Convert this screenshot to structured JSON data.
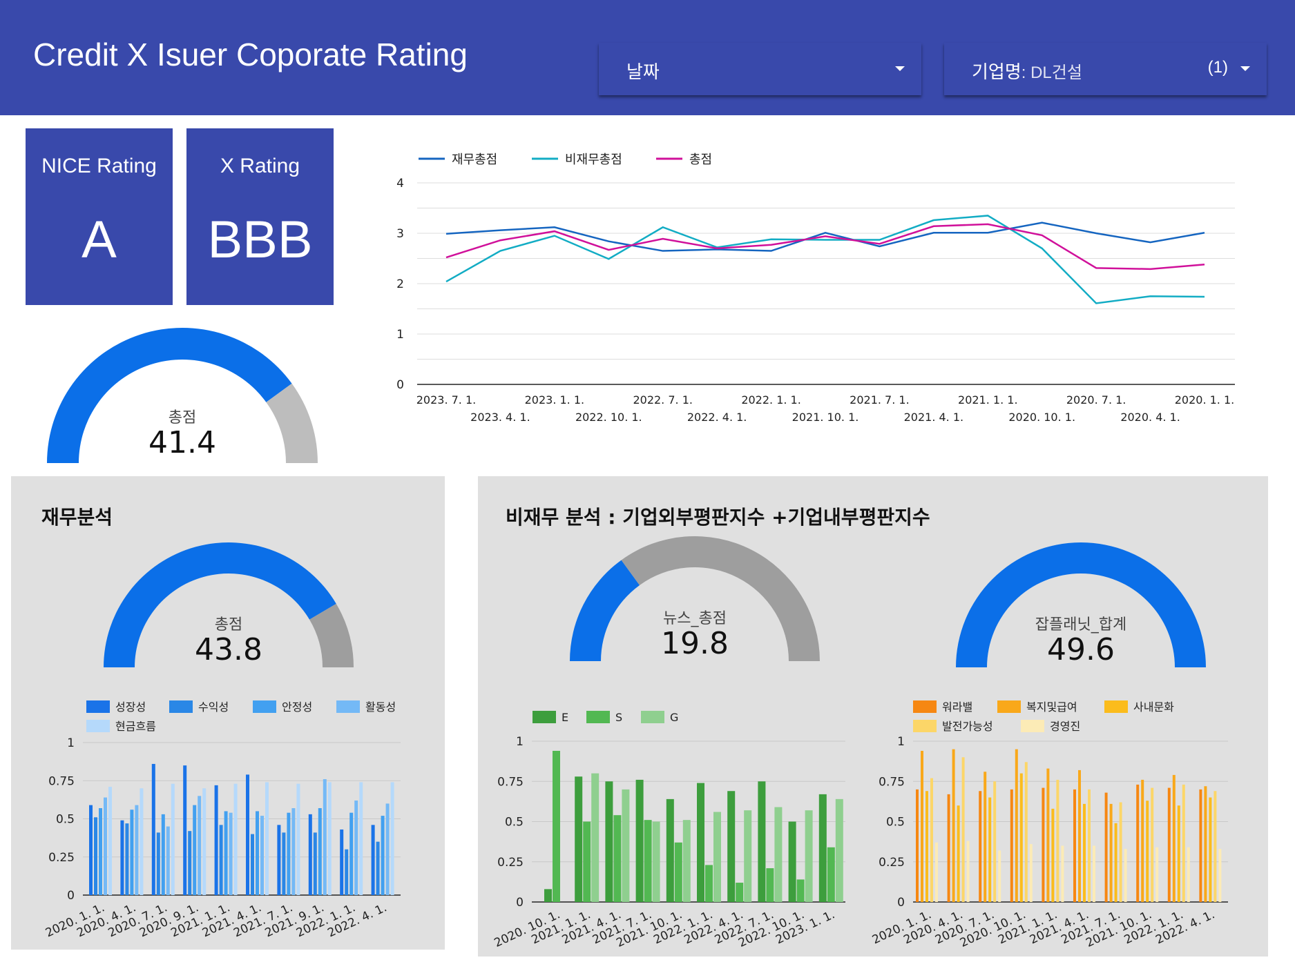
{
  "header": {
    "title": "Credit X Isuer Coporate Rating",
    "date_filter": {
      "label": "날짜"
    },
    "company_filter": {
      "label": "기업명",
      "value": ": DL건설",
      "count": "(1)"
    }
  },
  "scorecards": {
    "nice": {
      "label": "NICE Rating",
      "value": "A"
    },
    "x": {
      "label": "X Rating",
      "value": "BBB"
    }
  },
  "colors": {
    "header": "#3949ab",
    "gauge_fill": "#0b6fe8",
    "gauge_rest_light": "#bdbdbd",
    "gauge_rest_dark": "#9e9e9e",
    "panel_bg": "#e0e0e0"
  },
  "panels": {
    "financial": {
      "title": "재무분석"
    },
    "nonfinancial": {
      "title": "비재무 분석 : 기업외부평판지수 +기업내부평판지수"
    }
  },
  "chart_data": [
    {
      "id": "main-gauge",
      "type": "gauge",
      "label": "총점",
      "value": 41.4,
      "value_text": "41.4",
      "fill_fraction": 0.8
    },
    {
      "id": "score-line",
      "type": "line",
      "x": [
        "2023. 7. 1.",
        "2023. 4. 1.",
        "2023. 1. 1.",
        "2022. 10. 1.",
        "2022. 7. 1.",
        "2022. 4. 1.",
        "2022. 1. 1.",
        "2021. 10. 1.",
        "2021. 7. 1.",
        "2021. 4. 1.",
        "2021. 1. 1.",
        "2020. 10. 1.",
        "2020. 7. 1.",
        "2020. 4. 1.",
        "2020. 1. 1."
      ],
      "series": [
        {
          "name": "재무총점",
          "color": "#1565c0",
          "values": [
            2.99,
            3.06,
            3.12,
            2.84,
            2.65,
            2.68,
            2.65,
            3.01,
            2.74,
            3.01,
            3.01,
            3.21,
            3.0,
            2.82,
            3.01
          ]
        },
        {
          "name": "비재무총점",
          "color": "#12acc4",
          "values": [
            2.04,
            2.65,
            2.95,
            2.49,
            3.12,
            2.72,
            2.88,
            2.87,
            2.87,
            3.26,
            3.35,
            2.7,
            1.61,
            1.75,
            1.74
          ]
        },
        {
          "name": "총점",
          "color": "#d0109a",
          "values": [
            2.52,
            2.86,
            3.04,
            2.67,
            2.89,
            2.7,
            2.77,
            2.94,
            2.79,
            3.14,
            3.18,
            2.96,
            2.31,
            2.29,
            2.38
          ]
        }
      ],
      "yticks": [
        0,
        1,
        2,
        3,
        4
      ],
      "ylim": [
        0,
        4
      ],
      "legend": "top-left",
      "grid": true
    },
    {
      "id": "fin-gauge",
      "type": "gauge",
      "label": "총점",
      "value": 43.8,
      "value_text": "43.8",
      "fill_fraction": 0.83
    },
    {
      "id": "fin-bars",
      "type": "bar",
      "categories": [
        "2020. 1. 1.",
        "2020. 4. 1.",
        "2020. 7. 1.",
        "2020. 9. 1.",
        "2021. 1. 1.",
        "2021. 4. 1.",
        "2021. 7. 1.",
        "2021. 9. 1.",
        "2022. 1. 1.",
        "2022. 4. 1."
      ],
      "series": [
        {
          "name": "성장성",
          "color": "#1a73e8",
          "values": [
            0.59,
            0.49,
            0.86,
            0.85,
            0.72,
            0.79,
            0.46,
            0.53,
            0.43,
            0.46
          ]
        },
        {
          "name": "수익성",
          "color": "#2a87e6",
          "values": [
            0.51,
            0.47,
            0.41,
            0.42,
            0.46,
            0.4,
            0.41,
            0.41,
            0.3,
            0.35
          ]
        },
        {
          "name": "안정성",
          "color": "#42a0f0",
          "values": [
            0.57,
            0.56,
            0.53,
            0.59,
            0.55,
            0.55,
            0.54,
            0.57,
            0.54,
            0.52
          ]
        },
        {
          "name": "활동성",
          "color": "#74b9f6",
          "values": [
            0.64,
            0.59,
            0.45,
            0.65,
            0.54,
            0.52,
            0.57,
            0.76,
            0.62,
            0.6
          ]
        },
        {
          "name": "현금흐름",
          "color": "#b5d9fb",
          "values": [
            0.71,
            0.7,
            0.73,
            0.7,
            0.73,
            0.74,
            0.73,
            0.74,
            0.74,
            0.74
          ]
        }
      ],
      "yticks": [
        "0",
        "0.25",
        "0.5",
        "0.75",
        "1"
      ],
      "ylim": [
        0,
        1
      ]
    },
    {
      "id": "news-gauge",
      "type": "gauge",
      "label": "뉴스_총점",
      "value": 19.8,
      "value_text": "19.8",
      "fill_fraction": 0.3
    },
    {
      "id": "esg-bars",
      "type": "bar",
      "categories": [
        "2020. 10. 1.",
        "2021. 1. 1.",
        "2021. 4. 1.",
        "2021. 7. 1.",
        "2021. 10. 1.",
        "2022. 1. 1.",
        "2022. 4. 1.",
        "2022. 7. 1.",
        "2022. 10. 1.",
        "2023. 1. 1."
      ],
      "series": [
        {
          "name": "E",
          "color": "#3d9e3d",
          "values": [
            0.08,
            0.78,
            0.75,
            0.76,
            0.64,
            0.74,
            0.69,
            0.75,
            0.5,
            0.67
          ]
        },
        {
          "name": "S",
          "color": "#52b852",
          "values": [
            0.94,
            0.5,
            0.54,
            0.51,
            0.37,
            0.23,
            0.12,
            0.21,
            0.14,
            0.34
          ]
        },
        {
          "name": "G",
          "color": "#8fcf8f",
          "values": [
            0.0,
            0.8,
            0.7,
            0.5,
            0.51,
            0.56,
            0.57,
            0.59,
            0.57,
            0.64
          ]
        }
      ],
      "yticks": [
        "0",
        "0.25",
        "0.5",
        "0.75",
        "1"
      ],
      "ylim": [
        0,
        1
      ]
    },
    {
      "id": "job-gauge",
      "type": "gauge",
      "label": "잡플래닛_합계",
      "value": 49.6,
      "value_text": "49.6",
      "fill_fraction": 1.0
    },
    {
      "id": "job-bars",
      "type": "bar",
      "categories": [
        "2020. 1. 1.",
        "2020. 4. 1.",
        "2020. 7. 1.",
        "2020. 10. 1.",
        "2021. 1. 1.",
        "2021. 4. 1.",
        "2021. 7. 1.",
        "2021. 10. 1.",
        "2022. 1. 1.",
        "2022. 4. 1."
      ],
      "series": [
        {
          "name": "워라밸",
          "color": "#f68712",
          "values": [
            0.7,
            0.67,
            0.69,
            0.7,
            0.71,
            0.7,
            0.68,
            0.73,
            0.71,
            0.7
          ]
        },
        {
          "name": "복지및급여",
          "color": "#f9a81a",
          "values": [
            0.94,
            0.95,
            0.81,
            0.95,
            0.83,
            0.82,
            0.61,
            0.76,
            0.79,
            0.72
          ]
        },
        {
          "name": "사내문화",
          "color": "#fbbc1c",
          "values": [
            0.69,
            0.6,
            0.65,
            0.8,
            0.58,
            0.61,
            0.49,
            0.63,
            0.6,
            0.65
          ]
        },
        {
          "name": "발전가능성",
          "color": "#fcd668",
          "values": [
            0.77,
            0.9,
            0.75,
            0.87,
            0.76,
            0.7,
            0.62,
            0.71,
            0.73,
            0.69
          ]
        },
        {
          "name": "경영진",
          "color": "#fcebb6",
          "values": [
            0.37,
            0.38,
            0.32,
            0.36,
            0.35,
            0.35,
            0.33,
            0.34,
            0.34,
            0.33
          ]
        }
      ],
      "yticks": [
        "0",
        "0.25",
        "0.5",
        "0.75",
        "1"
      ],
      "ylim": [
        0,
        1
      ]
    }
  ]
}
